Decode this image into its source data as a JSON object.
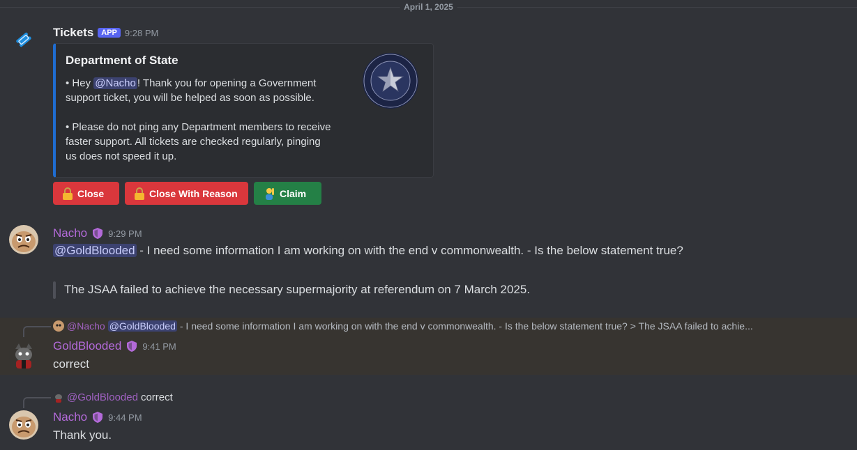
{
  "date_divider": "April 1, 2025",
  "colors": {
    "accent": "#5865f2",
    "nacho": "#b36ad9",
    "goldblooded": "#b36ad9",
    "embed_bar": "#1f6dd1",
    "button_red": "#da373c",
    "button_green": "#248046"
  },
  "bot_message": {
    "author": "Tickets",
    "badge": "APP",
    "time": "9:28 PM",
    "embed": {
      "title": "Department of State",
      "p1_prefix": "• Hey ",
      "p1_mention": "@Nacho",
      "p1_line1_rest": "! Thank you for opening a Government",
      "p1_line2": "support ticket, you will be helped as soon as possible.",
      "p2_line1": "• Please do not ping any Department members to receive",
      "p2_line2": "faster support. All tickets are checked regularly, pinging",
      "p2_line3": "us does not speed it up."
    },
    "buttons": {
      "close": "Close",
      "close_reason": "Close With Reason",
      "claim": "Claim"
    }
  },
  "message1": {
    "author": "Nacho",
    "time": "9:29 PM",
    "mention": "@GoldBlooded",
    "text": " - I need some information I am working on with the end v commonwealth. - Is the below statement true?",
    "quote": "The JSAA failed to achieve the necessary supermajority at referendum on 7 March 2025."
  },
  "message2": {
    "reply_author": "@Nacho",
    "reply_mention": "@GoldBlooded",
    "reply_text": " - I need some information I am working on with the end v commonwealth. - Is the below statement true?  > The JSAA failed to achie...",
    "author": "GoldBlooded",
    "time": "9:41 PM",
    "text": "correct"
  },
  "message3": {
    "reply_author": "@GoldBlooded",
    "reply_text": "correct",
    "author": "Nacho",
    "time": "9:44 PM",
    "text": "Thank you."
  }
}
